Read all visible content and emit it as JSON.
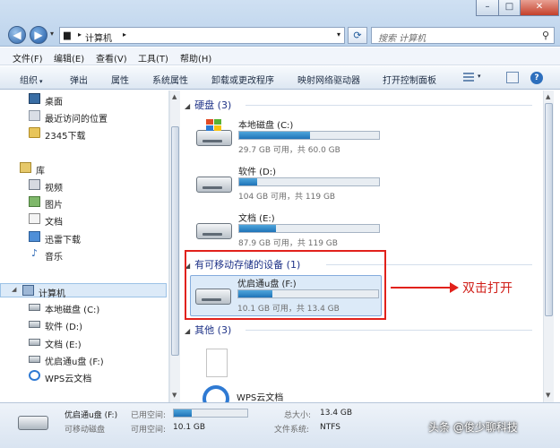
{
  "address": {
    "crumb": "计算机"
  },
  "search": {
    "placeholder": "搜索 计算机"
  },
  "menu": [
    "文件(F)",
    "编辑(E)",
    "查看(V)",
    "工具(T)",
    "帮助(H)"
  ],
  "toolbar": [
    "组织",
    "弹出",
    "属性",
    "系统属性",
    "卸载或更改程序",
    "映射网络驱动器",
    "打开控制面板"
  ],
  "sidebar": {
    "favorites": [
      "桌面",
      "最近访问的位置",
      "2345下载"
    ],
    "library_label": "库",
    "libraries": [
      "视频",
      "图片",
      "文档",
      "迅雷下载",
      "音乐"
    ],
    "computer_label": "计算机",
    "drives": [
      "本地磁盘 (C:)",
      "软件 (D:)",
      "文档 (E:)",
      "优启通u盘 (F:)",
      "WPS云文档"
    ]
  },
  "groups": {
    "hdd": "硬盘 (3)",
    "removable": "有可移动存储的设备 (1)",
    "other": "其他 (3)"
  },
  "drives": [
    {
      "name": "本地磁盘 (C:)",
      "info": "29.7 GB 可用，共 60.0 GB",
      "used_fraction": 0.505
    },
    {
      "name": "软件 (D:)",
      "info": "104 GB 可用，共 119 GB",
      "used_fraction": 0.126
    },
    {
      "name": "文档 (E:)",
      "info": "87.9 GB 可用，共 119 GB",
      "used_fraction": 0.261
    },
    {
      "name": "优启通u盘 (F:)",
      "info": "10.1 GB 可用，共 13.4 GB",
      "used_fraction": 0.246
    }
  ],
  "other_items": {
    "wps": "WPS云文档"
  },
  "annotation": "双击打开",
  "status": {
    "name": "优启通u盘 (F:)",
    "type": "可移动磁盘",
    "used_label": "已用空间:",
    "used_fraction": 0.246,
    "free_label": "可用空间:",
    "free_value": "10.1 GB",
    "total_label": "总大小:",
    "total_value": "13.4 GB",
    "fs_label": "文件系统:",
    "fs_value": "NTFS"
  },
  "watermark": "头条 @俊少聊科技",
  "colors": {
    "accent": "#1f73b8",
    "annotation": "#e1211b"
  }
}
